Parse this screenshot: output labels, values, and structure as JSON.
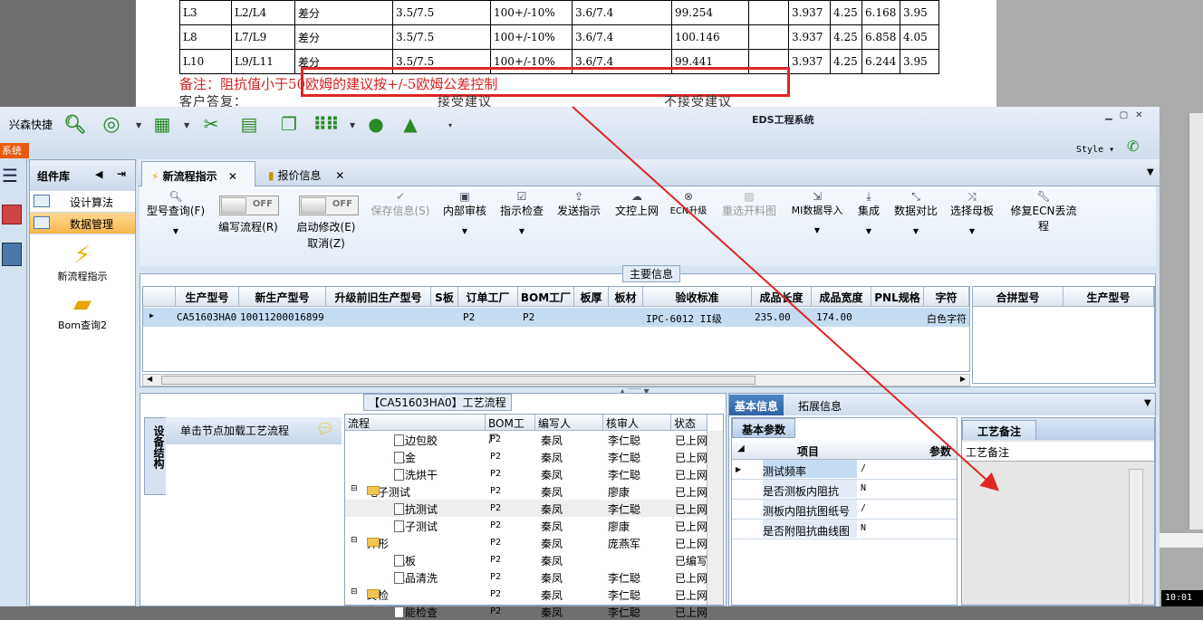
{
  "document": {
    "rows": [
      [
        "L3",
        "L2/L4",
        "差分",
        "3.5/7.5",
        "100+/-10%",
        "3.6/7.4",
        "99.254",
        "",
        "3.937",
        "4.25",
        "6.168",
        "3.95"
      ],
      [
        "L8",
        "L7/L9",
        "差分",
        "3.5/7.5",
        "100+/-10%",
        "3.6/7.4",
        "100.146",
        "",
        "3.937",
        "4.25",
        "6.858",
        "4.05"
      ],
      [
        "L10",
        "L9/L11",
        "差分",
        "3.5/7.5",
        "100+/-10%",
        "3.6/7.4",
        "99.441",
        "",
        "3.937",
        "4.25",
        "6.244",
        "3.95"
      ]
    ],
    "note": "备注：阻抗值小于50欧姆的建议按+/-5欧姆公差控制",
    "reply_a": "客户答复：",
    "reply_b": "接受建议",
    "reply_c": "不接受建议"
  },
  "app": {
    "quick_launch": "兴森快捷",
    "title": "EDS工程系统",
    "style_label": "Style",
    "side_tag": "系统",
    "component_panel": {
      "title": "组件库",
      "items": [
        {
          "label": "设计算法"
        },
        {
          "label": "数据管理"
        }
      ],
      "icons": [
        {
          "label": "新流程指示"
        },
        {
          "label": "Bom查询2"
        }
      ]
    },
    "tabs": [
      {
        "label": "新流程指示"
      },
      {
        "label": "报价信息"
      }
    ],
    "ribbon": [
      {
        "label": "型号查询(F)"
      },
      {
        "label": "编写流程(R)"
      },
      {
        "label": "启动修改(E)"
      },
      {
        "label": "取消(Z)"
      },
      {
        "label": "保存信息(S)"
      },
      {
        "label": "内部审核"
      },
      {
        "label": "指示检查"
      },
      {
        "label": "发送指示"
      },
      {
        "label": "文控上网"
      },
      {
        "label": "ECN升级"
      },
      {
        "label": "重选开料图"
      },
      {
        "label": "MI数据导入"
      },
      {
        "label": "集成"
      },
      {
        "label": "数据对比"
      },
      {
        "label": "选择母板"
      },
      {
        "label": "修复ECN丢流程"
      }
    ],
    "toggle_off": "OFF",
    "main_info": {
      "caption": "主要信息",
      "columns": [
        "生产型号",
        "新生产型号",
        "升级前旧生产型号",
        "S板",
        "订单工厂",
        "BOM工厂",
        "板厚",
        "板材",
        "验收标准",
        "成品长度",
        "成品宽度",
        "PNL规格",
        "字符"
      ],
      "row": [
        "CA51603HA0",
        "10011200016899",
        "",
        "",
        "P2",
        "P2",
        "",
        "",
        "IPC-6012 II级",
        "235.00",
        "174.00",
        "",
        "白色字符"
      ],
      "side_columns": [
        "合拼型号",
        "生产型号"
      ]
    },
    "flow": {
      "caption": "【CA51603HA0】工艺流程",
      "side_tab": "设备结构",
      "load_hint": "单击节点加载工艺流程",
      "columns": [
        "流程",
        "BOM工厂",
        "编写人",
        "核审人",
        "状态"
      ],
      "rows": [
        {
          "name": "板边包胶",
          "level": 2,
          "bom": "P2",
          "writer": "秦凤",
          "reviewer": "李仁聪",
          "status": "已上网"
        },
        {
          "name": "沉金",
          "level": 2,
          "bom": "P2",
          "writer": "秦凤",
          "reviewer": "李仁聪",
          "status": "已上网"
        },
        {
          "name": "水洗烘干",
          "level": 2,
          "bom": "P2",
          "writer": "秦凤",
          "reviewer": "李仁聪",
          "status": "已上网"
        },
        {
          "name": "电子测试",
          "level": 1,
          "bom": "P2",
          "writer": "秦凤",
          "reviewer": "廖康",
          "status": "已上网"
        },
        {
          "name": "阻抗测试",
          "level": 2,
          "bom": "P2",
          "writer": "秦凤",
          "reviewer": "李仁聪",
          "status": "已上网"
        },
        {
          "name": "电子测试",
          "level": 2,
          "bom": "P2",
          "writer": "秦凤",
          "reviewer": "廖康",
          "status": "已上网"
        },
        {
          "name": "外形",
          "level": 1,
          "bom": "P2",
          "writer": "秦凤",
          "reviewer": "庞燕军",
          "status": "已上网"
        },
        {
          "name": "铣板",
          "level": 2,
          "bom": "P2",
          "writer": "秦凤",
          "reviewer": "",
          "status": "已编写"
        },
        {
          "name": "成品清洗",
          "level": 2,
          "bom": "P2",
          "writer": "秦凤",
          "reviewer": "李仁聪",
          "status": "已上网"
        },
        {
          "name": "终检",
          "level": 1,
          "bom": "P2",
          "writer": "秦凤",
          "reviewer": "李仁聪",
          "status": "已上网"
        },
        {
          "name": "功能检查",
          "level": 2,
          "bom": "P2",
          "writer": "秦凤",
          "reviewer": "李仁聪",
          "status": "已上网"
        }
      ]
    },
    "basic": {
      "tab_basic": "基本信息",
      "tab_ext": "拓展信息",
      "params_tab": "基本参数",
      "col_item": "项目",
      "col_param": "参数",
      "params": [
        {
          "item": "测试频率",
          "value": "/"
        },
        {
          "item": "是否测板内阻抗",
          "value": "N"
        },
        {
          "item": "测板内阻抗图纸号",
          "value": "/"
        },
        {
          "item": "是否附阻抗曲线图",
          "value": "N"
        }
      ],
      "memo_tab": "工艺备注",
      "memo_label": "工艺备注"
    }
  },
  "taskbar": {
    "clock": "10:01"
  },
  "colors": {
    "annotation": "#e02525",
    "ribbon_icon": "#2a8a2a",
    "tab_active": "#2d62a4"
  }
}
